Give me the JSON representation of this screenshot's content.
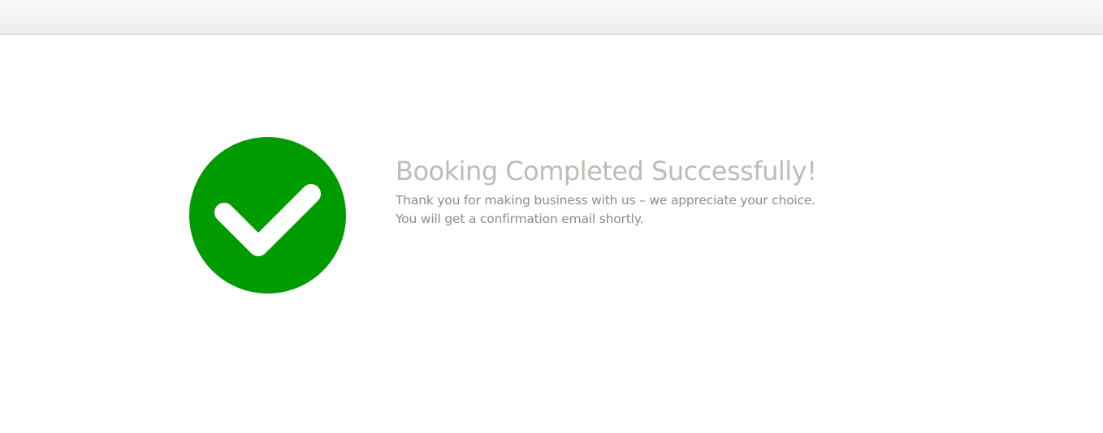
{
  "header": {},
  "status": {
    "icon": "check-circle-icon",
    "icon_color": "#009b00",
    "check_color": "#ffffff"
  },
  "message": {
    "title": "Booking Completed Successfully!",
    "line1": "Thank you for making business with us – we appreciate your choice.",
    "line2": "You will get a confirmation email shortly."
  }
}
